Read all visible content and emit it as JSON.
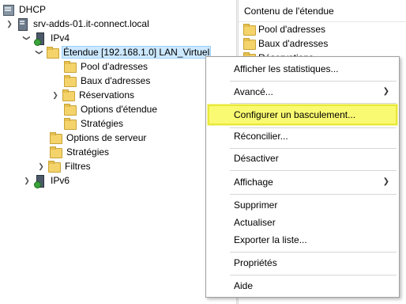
{
  "tree": {
    "root": "DHCP",
    "server": "srv-adds-01.it-connect.local",
    "ipv4": "IPv4",
    "scope": "Étendue [192.168.1.0] LAN_Virtuel",
    "scope_children": [
      "Pool d'adresses",
      "Baux d'adresses",
      "Réservations",
      "Options d'étendue",
      "Stratégies"
    ],
    "server_options": "Options de serveur",
    "policies": "Stratégies",
    "filters": "Filtres",
    "ipv6": "IPv6"
  },
  "right_pane": {
    "header": "Contenu de l'étendue",
    "items": [
      "Pool d'adresses",
      "Baux d'adresses",
      "Réservations"
    ]
  },
  "context_menu": {
    "items": [
      "Afficher les statistiques...",
      "Avancé...",
      "Configurer un basculement...",
      "Réconcilier...",
      "Désactiver",
      "Affichage",
      "Supprimer",
      "Actualiser",
      "Exporter la liste...",
      "Propriétés",
      "Aide"
    ]
  },
  "colors": {
    "highlight": "#fafa72",
    "selection": "#cce8ff",
    "folder": "#f4d36b"
  }
}
